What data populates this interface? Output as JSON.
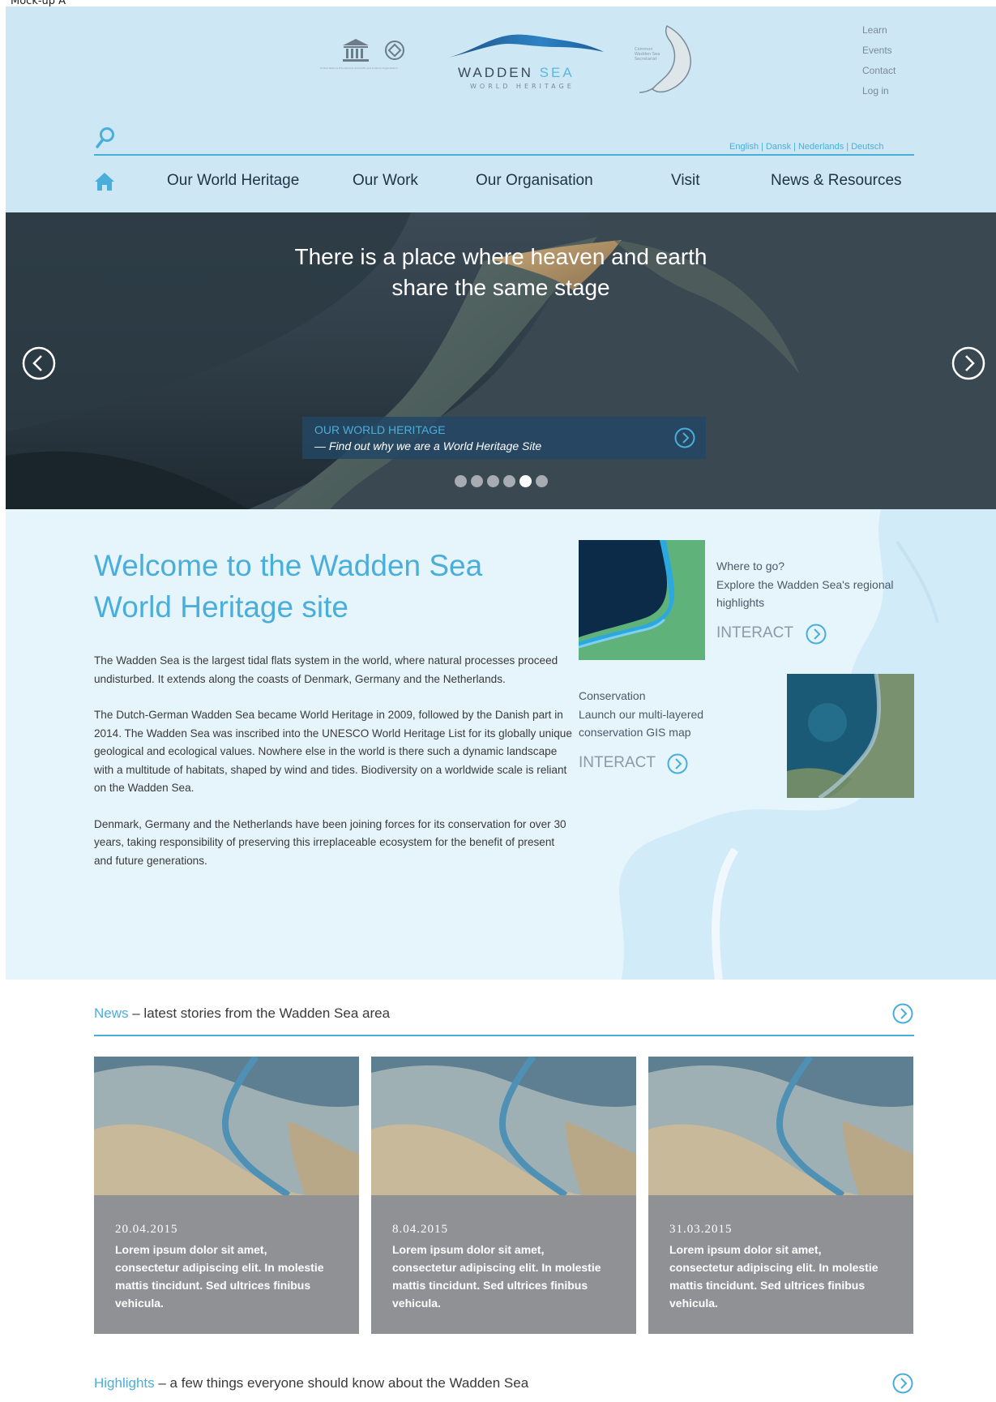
{
  "mockup_label": "Mock-up A",
  "header": {
    "unesco_caption": "United Nations Educational, Scientific and Cultural Organization",
    "logo_title_main": "WADDEN",
    "logo_title_accent": "SEA",
    "logo_subtitle": "WORLD HERITAGE",
    "cwss_caption": "Common Wadden Sea Secretariat",
    "utility_links": [
      "Learn",
      "Events",
      "Contact",
      "Log in"
    ],
    "languages": [
      "English",
      "Dansk",
      "Nederlands",
      "Deutsch"
    ],
    "nav": [
      "Our World Heritage",
      "Our Work",
      "Our Organisation",
      "Visit",
      "News & Resources"
    ]
  },
  "hero": {
    "headline_line1": "There is a place where heaven and earth",
    "headline_line2": "share the same stage",
    "callout_title": "OUR WORLD HERITAGE",
    "callout_subtitle": "— Find out why we are a World Heritage Site",
    "slide_count": 6,
    "active_slide": 5
  },
  "welcome": {
    "title": "Welcome to the Wadden Sea World Heritage site",
    "paragraphs": [
      "The Wadden Sea is the largest tidal flats system in the world, where natural processes proceed undisturbed. It extends along the coasts of Denmark, Germany and the Netherlands.",
      "The Dutch-German Wadden Sea became World Heritage in 2009, followed by the Danish part in 2014. The Wadden Sea was inscribed into the UNESCO World Heritage List for its globally unique geological and ecological values. Nowhere else in the world is there such a dynamic landscape with a multitude of habitats, shaped by wind and tides. Biodiversity on a worldwide scale is reliant on the Wadden Sea.",
      "Denmark, Germany and the Netherlands have been joining forces for its conservation for over 30 years, taking responsibility of preserving this irreplaceable ecosystem for the benefit of present and future generations."
    ],
    "where_heading": "Where to go?",
    "where_text": "Explore the Wadden Sea's regional highlights",
    "where_cta": "INTERACT",
    "conservation_heading": "Conservation",
    "conservation_text": "Launch our multi-layered conservation GIS map",
    "conservation_cta": "INTERACT"
  },
  "news": {
    "title_accent": "News",
    "title_rest": " – latest stories from the Wadden Sea area",
    "items": [
      {
        "date": "20.04.2015",
        "text": "Lorem ipsum dolor sit amet, consectetur adipiscing elit. In molestie mattis tincidunt. Sed ultrices finibus vehicula."
      },
      {
        "date": "8.04.2015",
        "text": "Lorem ipsum dolor sit amet, consectetur adipiscing elit. In molestie mattis tincidunt. Sed ultrices finibus vehicula."
      },
      {
        "date": "31.03.2015",
        "text": "Lorem ipsum dolor sit amet, consectetur adipiscing elit. In molestie mattis tincidunt. Sed ultrices finibus vehicula."
      }
    ]
  },
  "highlights": {
    "title_accent": "Highlights",
    "title_rest": " – a few things everyone should know about the Wadden Sea"
  },
  "colors": {
    "accent": "#4aaedb",
    "header_bg": "#cde7f5",
    "welcome_bg": "#e6f4fc",
    "news_card_bg": "#8f9194",
    "nav_text": "#1f3347"
  }
}
